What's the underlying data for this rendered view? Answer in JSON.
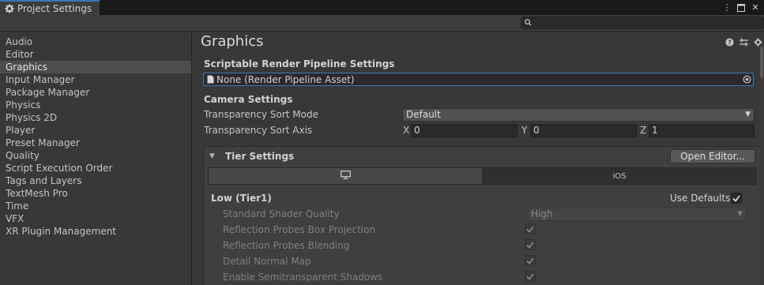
{
  "window": {
    "tab_title": "Project Settings"
  },
  "search": {
    "placeholder": ""
  },
  "sidebar": {
    "items": [
      {
        "label": "Audio"
      },
      {
        "label": "Editor"
      },
      {
        "label": "Graphics"
      },
      {
        "label": "Input Manager"
      },
      {
        "label": "Package Manager"
      },
      {
        "label": "Physics"
      },
      {
        "label": "Physics 2D"
      },
      {
        "label": "Player"
      },
      {
        "label": "Preset Manager"
      },
      {
        "label": "Quality"
      },
      {
        "label": "Script Execution Order"
      },
      {
        "label": "Tags and Layers"
      },
      {
        "label": "TextMesh Pro"
      },
      {
        "label": "Time"
      },
      {
        "label": "VFX"
      },
      {
        "label": "XR Plugin Management"
      }
    ],
    "selected": "Graphics"
  },
  "main": {
    "title": "Graphics",
    "srp": {
      "heading": "Scriptable Render Pipeline Settings",
      "value": "None (Render Pipeline Asset)"
    },
    "camera": {
      "heading": "Camera Settings",
      "sort_mode_label": "Transparency Sort Mode",
      "sort_mode_value": "Default",
      "sort_axis_label": "Transparency Sort Axis",
      "axis": {
        "x_label": "X",
        "x_value": "0",
        "y_label": "Y",
        "y_value": "0",
        "z_label": "Z",
        "z_value": "1"
      }
    },
    "tier": {
      "heading": "Tier Settings",
      "open_editor": "Open Editor...",
      "platform_tabs": [
        {
          "label": "",
          "icon": "monitor-icon",
          "active": true
        },
        {
          "label": "iOS",
          "active": false
        }
      ],
      "tier_name": "Low (Tier1)",
      "use_defaults_label": "Use Defaults",
      "use_defaults_checked": true,
      "rows": [
        {
          "label": "Standard Shader Quality",
          "type": "dropdown",
          "value": "High"
        },
        {
          "label": "Reflection Probes Box Projection",
          "type": "checkbox",
          "checked": true
        },
        {
          "label": "Reflection Probes Blending",
          "type": "checkbox",
          "checked": true
        },
        {
          "label": "Detail Normal Map",
          "type": "checkbox",
          "checked": true
        },
        {
          "label": "Enable Semitransparent Shadows",
          "type": "checkbox",
          "checked": true
        }
      ]
    }
  },
  "colors": {
    "accent": "#3a79bb",
    "background": "#383838",
    "field": "#2a2a2a",
    "selected_row": "#4d4d4d"
  }
}
